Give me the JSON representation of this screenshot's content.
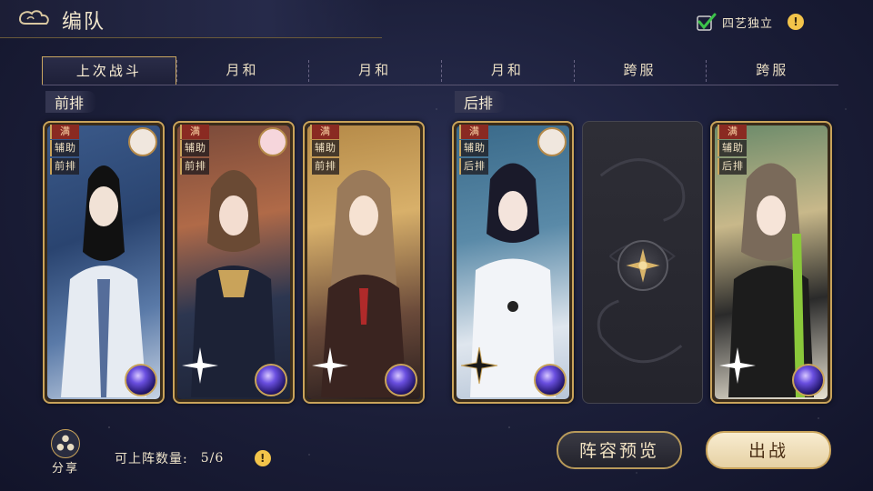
{
  "header": {
    "title": "编队",
    "independent_label": "四艺独立",
    "independent_checked": true
  },
  "tabs": [
    {
      "label": "上次战斗",
      "active": true
    },
    {
      "label": "月和",
      "active": false
    },
    {
      "label": "月和",
      "active": false
    },
    {
      "label": "月和",
      "active": false
    },
    {
      "label": "跨服",
      "active": false
    },
    {
      "label": "跨服",
      "active": false
    }
  ],
  "front_row": {
    "label": "前排",
    "cards": [
      {
        "status": "满",
        "role": "辅助",
        "row": "前排",
        "pet": "cat-pet",
        "accent": "#3b5a8a"
      },
      {
        "status": "满",
        "role": "辅助",
        "row": "前排",
        "pet": "pig-pet",
        "accent": "#b06a48"
      },
      {
        "status": "满",
        "role": "辅助",
        "row": "前排",
        "pet": null,
        "accent": "#d8b06a"
      }
    ]
  },
  "back_row": {
    "label": "后排",
    "cards": [
      {
        "status": "满",
        "role": "辅助",
        "row": "后排",
        "pet": "cat-pet",
        "accent": "#5a8aa8"
      },
      {
        "empty": true
      },
      {
        "status": "满",
        "role": "辅助",
        "row": "后排",
        "pet": null,
        "accent": "#c8b88a"
      }
    ]
  },
  "footer": {
    "share_label": "分享",
    "capacity_label": "可上阵数量:",
    "capacity_value": "5/6",
    "preview_button": "阵容预览",
    "fight_button": "出战"
  },
  "colors": {
    "gold": "#c9a35a",
    "info": "#f3c44a",
    "check": "#3cc24a"
  }
}
